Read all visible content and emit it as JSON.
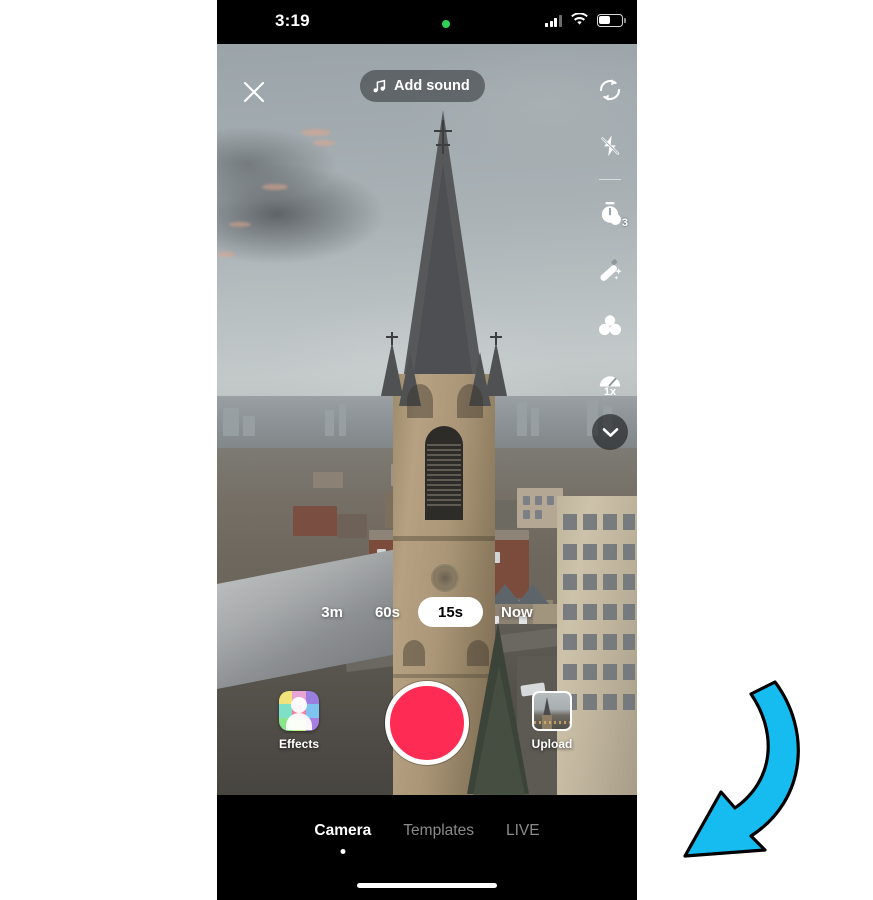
{
  "status_bar": {
    "time": "3:19",
    "recording_indicator": "green-dot",
    "cellular_icon": "cellular-signal-icon",
    "wifi_icon": "wifi-icon",
    "battery_icon": "battery-icon"
  },
  "camera": {
    "close_label": "×",
    "close_icon": "close-icon",
    "add_sound_label": "Add sound",
    "music_icon": "music-note-icon",
    "scene_description": "Aerial view of a gothic church steeple against a cloudy gray sky over a city neighborhood"
  },
  "tool_rail": {
    "items": [
      {
        "icon": "flip-camera-icon",
        "label": "Flip"
      },
      {
        "icon": "flash-off-icon",
        "label": "Flash"
      },
      {
        "icon": "timer-icon",
        "label": "Timer",
        "badge": "3"
      },
      {
        "icon": "magic-wand-icon",
        "label": "Filters"
      },
      {
        "icon": "beauty-icon",
        "label": "Enhance"
      },
      {
        "icon": "speed-icon",
        "label": "Speed",
        "badge": "1x"
      }
    ],
    "expand_icon": "chevron-down-icon",
    "expand_label": "More"
  },
  "durations": {
    "options": [
      {
        "label": "3m",
        "selected": false
      },
      {
        "label": "60s",
        "selected": false
      },
      {
        "label": "15s",
        "selected": true
      },
      {
        "label": "Now",
        "selected": false
      }
    ]
  },
  "shutter": {
    "record_label": "Record",
    "record_color": "#FE2C55",
    "effects_label": "Effects",
    "effects_icon": "effects-icon",
    "upload_label": "Upload",
    "upload_icon": "upload-thumbnail-icon"
  },
  "bottom_nav": {
    "tabs": [
      {
        "label": "Camera",
        "active": true
      },
      {
        "label": "Templates",
        "active": false
      },
      {
        "label": "LIVE",
        "active": false
      }
    ]
  },
  "annotation": {
    "arrow_icon": "curved-arrow-icon",
    "arrow_color": "#16BCF0",
    "points_to": "LIVE"
  }
}
